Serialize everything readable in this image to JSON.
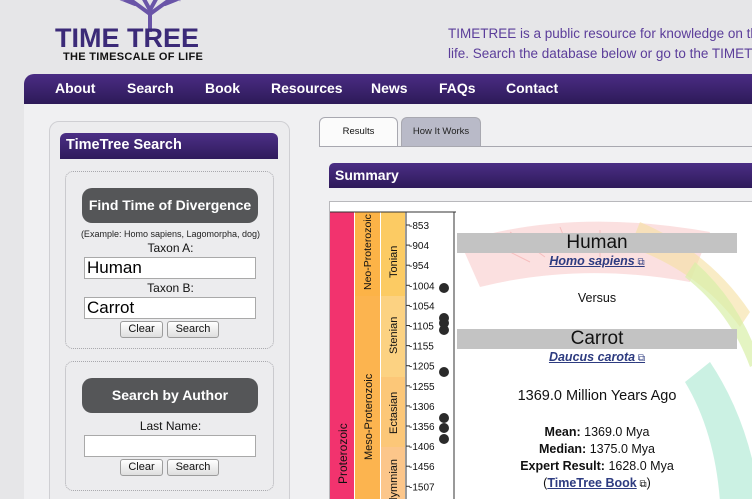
{
  "header": {
    "logo_title": "TIME TREE",
    "logo_subtitle": "THE TIMESCALE OF LIFE",
    "intro_line1": "TIMETREE is a public resource for knowledge on the",
    "intro_line2": "life. Search the database below or go to the TIMETR"
  },
  "nav": {
    "items": [
      {
        "label": "About"
      },
      {
        "label": "Search"
      },
      {
        "label": "Book"
      },
      {
        "label": "Resources"
      },
      {
        "label": "News"
      },
      {
        "label": "FAQs"
      },
      {
        "label": "Contact"
      }
    ]
  },
  "sidebar": {
    "title": "TimeTree Search",
    "divergence": {
      "button_label": "Find Time of Divergence",
      "example": "(Example: Homo sapiens, Lagomorpha, dog)",
      "taxon_a_label": "Taxon A:",
      "taxon_a_value": "Human",
      "taxon_b_label": "Taxon B:",
      "taxon_b_value": "Carrot",
      "clear_label": "Clear",
      "search_label": "Search"
    },
    "author": {
      "button_label": "Search by Author",
      "last_name_label": "Last Name:",
      "last_name_value": "",
      "clear_label": "Clear",
      "search_label": "Search"
    }
  },
  "tabs": [
    {
      "label": "Results",
      "active": true
    },
    {
      "label": "How It Works",
      "active": false
    }
  ],
  "summary": {
    "title": "Summary",
    "taxon_a_common": "Human",
    "taxon_a_scientific": "Homo sapiens",
    "versus": "Versus",
    "taxon_b_common": "Carrot",
    "taxon_b_scientific": "Daucus carota",
    "divergence_time": "1369.0 Million Years Ago",
    "mean_label": "Mean:",
    "mean_value": "1369.0 Mya",
    "median_label": "Median:",
    "median_value": "1375.0 Mya",
    "expert_label": "Expert Result:",
    "expert_value": "1628.0 Mya",
    "book_link": "TimeTree Book",
    "external_link_icon": "external-link-icon"
  },
  "timeline": {
    "eon": "Proterozoic",
    "eras": [
      "Neo-Proterozoic",
      "Meso-Proterozoic"
    ],
    "periods": [
      "Tonian",
      "Stenian",
      "Ectasian",
      "Calymmian"
    ],
    "ticks": [
      "-853",
      "-904",
      "-954",
      "-1004",
      "-1054",
      "-1105",
      "-1155",
      "-1205",
      "-1255",
      "-1306",
      "-1356",
      "-1406",
      "-1456",
      "-1507"
    ],
    "colors": {
      "eon": "#f2336e",
      "era_neo": "#fcb347",
      "era_meso": "#fcb44f",
      "period_tonian": "#fccb63",
      "period_stenian": "#fcd282",
      "period_ectasian": "#fcc778",
      "period_calymmian": "#fcc68a"
    },
    "dot_count": 8
  },
  "colors": {
    "nav_purple": "#3b2470",
    "link_blue": "#2d3b80",
    "intro_purple": "#5b3d9a"
  }
}
